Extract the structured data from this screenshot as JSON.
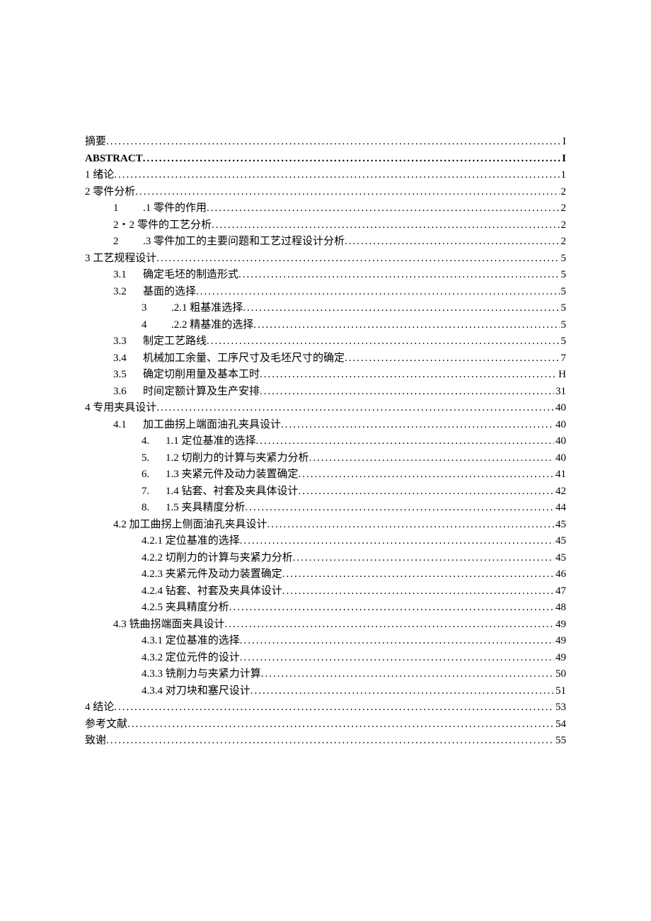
{
  "toc": [
    {
      "label": "摘要 ",
      "page": "I",
      "indent": 0,
      "bold": false
    },
    {
      "label": "ABSTRACT",
      "page": "I",
      "indent": 0,
      "bold": true
    },
    {
      "label": "1 绪论",
      "page": "1",
      "indent": 0,
      "bold": false
    },
    {
      "label": "2 零件分析",
      "page": "2",
      "indent": 0,
      "bold": false
    },
    {
      "num": "1",
      "label": ".1 零件的作用",
      "page": "2",
      "indent": 1,
      "bold": false
    },
    {
      "num": "2・2",
      "label": "零件的工艺分析",
      "page": "2",
      "indent": 1,
      "bold": false,
      "narrow": true
    },
    {
      "num": "2",
      "label": ".3 零件加工的主要问题和工艺过程设计分析",
      "page": "2",
      "indent": 1,
      "bold": false
    },
    {
      "label": "3 工艺规程设计",
      "page": "5",
      "indent": 0,
      "bold": false
    },
    {
      "num": "3.1",
      "label": "确定毛坯的制造形式",
      "page": "5",
      "indent": 1,
      "bold": false
    },
    {
      "num": "3.2",
      "label": "基面的选择",
      "page": "5",
      "indent": 1,
      "bold": false
    },
    {
      "num": "3",
      "label": ".2.1 粗基准选择",
      "page": "5",
      "indent": 2,
      "bold": false
    },
    {
      "num": "4",
      "label": ".2.2 精基准的选择",
      "page": "5",
      "indent": 2,
      "bold": false
    },
    {
      "num": "3.3",
      "label": "制定工艺路线",
      "page": "5",
      "indent": 1,
      "bold": false
    },
    {
      "num": "3.4",
      "label": "机械加工余量、工序尺寸及毛坯尺寸的确定",
      "page": "7",
      "indent": 1,
      "bold": false
    },
    {
      "num": "3.5",
      "label": "确定切削用量及基本工时 ",
      "page": "H",
      "indent": 1,
      "bold": false
    },
    {
      "num": "3.6",
      "label": "时间定额计算及生产安排",
      "page": "31",
      "indent": 1,
      "bold": false
    },
    {
      "label": "4 专用夹具设计",
      "page": "40",
      "indent": 0,
      "bold": false
    },
    {
      "num": "4.1",
      "label": "加工曲拐上端面油孔夹具设计",
      "page": "40",
      "indent": 1,
      "bold": false
    },
    {
      "num": "4.",
      "label": "1.1 定位基准的选择",
      "page": "40",
      "indent": 2,
      "bold": false,
      "narrow": true
    },
    {
      "num": "5.",
      "label": "1.2 切削力的计算与夹紧力分析",
      "page": "40",
      "indent": 2,
      "bold": false,
      "narrow": true
    },
    {
      "num": "6.",
      "label": "1.3 夹紧元件及动力装置确定",
      "page": "41",
      "indent": 2,
      "bold": false,
      "narrow": true
    },
    {
      "num": "7.",
      "label": "1.4 钻套、衬套及夹具体设计",
      "page": "42",
      "indent": 2,
      "bold": false,
      "narrow": true
    },
    {
      "num": "8.",
      "label": "1.5 夹具精度分析",
      "page": "44",
      "indent": 2,
      "bold": false,
      "narrow": true
    },
    {
      "label": "4.2 加工曲拐上侧面油孔夹具设计 ",
      "page": "45",
      "indent": 1,
      "bold": false
    },
    {
      "label": "4.2.1 定位基准的选择 ",
      "page": "45",
      "indent": 2,
      "bold": false
    },
    {
      "label": "4.2.2 切削力的计算与夹紧力分析 ",
      "page": "45",
      "indent": 2,
      "bold": false
    },
    {
      "label": "4.2.3 夹紧元件及动力装置确定 ",
      "page": "46",
      "indent": 2,
      "bold": false
    },
    {
      "label": "4.2.4 钻套、衬套及夹具体设计 ",
      "page": "47",
      "indent": 2,
      "bold": false
    },
    {
      "label": "4.2.5 夹具精度分析 ",
      "page": "48",
      "indent": 2,
      "bold": false
    },
    {
      "label": "4.3 铣曲拐端面夹具设计 ",
      "page": "49",
      "indent": 1,
      "bold": false
    },
    {
      "label": "4.3.1 定位基准的选择 ",
      "page": "49",
      "indent": 2,
      "bold": false
    },
    {
      "label": "4.3.2 定位元件的设计 ",
      "page": "49",
      "indent": 2,
      "bold": false
    },
    {
      "label": "4.3.3 铣削力与夹紧力计算 ",
      "page": "50",
      "indent": 2,
      "bold": false
    },
    {
      "label": "4.3.4 对刀块和塞尺设计 ",
      "page": "51",
      "indent": 2,
      "bold": false
    },
    {
      "label": "4 结论",
      "page": "53",
      "indent": 0,
      "bold": false
    },
    {
      "label": "参考文献",
      "page": "54",
      "indent": 0,
      "bold": false
    },
    {
      "label": "致谢",
      "page": "55",
      "indent": 0,
      "bold": false
    }
  ]
}
